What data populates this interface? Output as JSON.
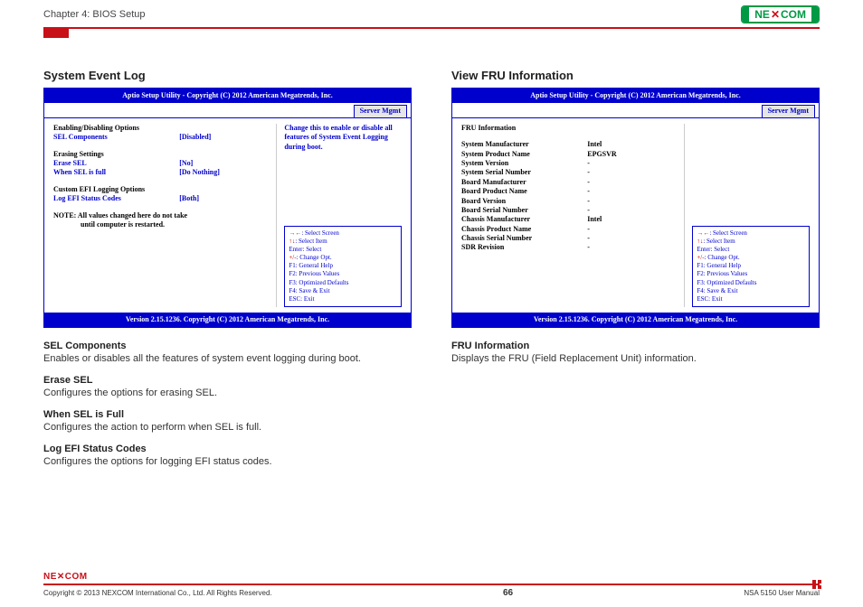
{
  "header": {
    "chapter": "Chapter 4: BIOS Setup",
    "logo_text": "NE COM"
  },
  "left": {
    "title": "System Event Log",
    "bios": {
      "top": "Aptio Setup Utility - Copyright (C) 2012 American Megatrends, Inc.",
      "tab": "Server Mgmt",
      "footer": "Version 2.15.1236. Copyright (C) 2012 American Megatrends, Inc.",
      "help_top": "Change this to enable or disable all features of System Event Logging during boot.",
      "group1": "Enabling/Disabling Options",
      "row_sel": {
        "k": "SEL Components",
        "v": "[Disabled]"
      },
      "group2": "Erasing Settings",
      "row_erase": {
        "k": "Erase SEL",
        "v": "[No]"
      },
      "row_full": {
        "k": "When SEL is full",
        "v": "[Do Nothing]"
      },
      "group3": "Custom EFI Logging Options",
      "row_log": {
        "k": "Log EFI Status Codes",
        "v": "[Both]"
      },
      "note1": "NOTE: All values changed here do not take",
      "note2": "until computer is restarted."
    },
    "desc": [
      {
        "h": "SEL Components",
        "p": "Enables or disables all the features of system event logging during boot."
      },
      {
        "h": "Erase SEL",
        "p": "Configures the options for erasing SEL."
      },
      {
        "h": "When SEL is Full",
        "p": "Configures the action to perform when SEL is full."
      },
      {
        "h": "Log EFI Status Codes",
        "p": "Configures the options for logging EFI status codes."
      }
    ]
  },
  "right": {
    "title": "View FRU Information",
    "bios": {
      "top": "Aptio Setup Utility - Copyright (C) 2012 American Megatrends, Inc.",
      "tab": "Server Mgmt",
      "footer": "Version 2.15.1236. Copyright (C) 2012 American Megatrends, Inc.",
      "group": "FRU Information",
      "rows": [
        {
          "k": "System Manufacturer",
          "v": "Intel"
        },
        {
          "k": "System Product Name",
          "v": "EPGSVR"
        },
        {
          "k": "System Version",
          "v": "-"
        },
        {
          "k": "System Serial Number",
          "v": "-"
        },
        {
          "k": "Board Manufacturer",
          "v": "-"
        },
        {
          "k": "Board Product Name",
          "v": "-"
        },
        {
          "k": "Board Version",
          "v": "-"
        },
        {
          "k": "Board Serial Number",
          "v": "-"
        },
        {
          "k": "Chassis Manufacturer",
          "v": "Intel"
        },
        {
          "k": "Chassis Product Name",
          "v": "-"
        },
        {
          "k": "Chassis Serial Number",
          "v": "-"
        },
        {
          "k": "SDR Revision",
          "v": "-"
        }
      ]
    },
    "desc": [
      {
        "h": "FRU Information",
        "p": "Displays the FRU (Field Replacement Unit) information."
      }
    ]
  },
  "navkeys": {
    "l1a": "→←",
    "l1b": ": Select Screen",
    "l2a": "↑↓",
    "l2b": ": Select Item",
    "l3": "Enter: Select",
    "l4a": "+/-",
    "l4b": ": Change Opt.",
    "l5": "F1: General Help",
    "l6": "F2: Previous Values",
    "l7": "F3: Optimized Defaults",
    "l8": "F4: Save & Exit",
    "l9": "ESC: Exit"
  },
  "footer": {
    "logo": "NE COM",
    "copyright": "Copyright © 2013 NEXCOM International Co., Ltd. All Rights Reserved.",
    "page": "66",
    "manual": "NSA 5150 User Manual"
  }
}
